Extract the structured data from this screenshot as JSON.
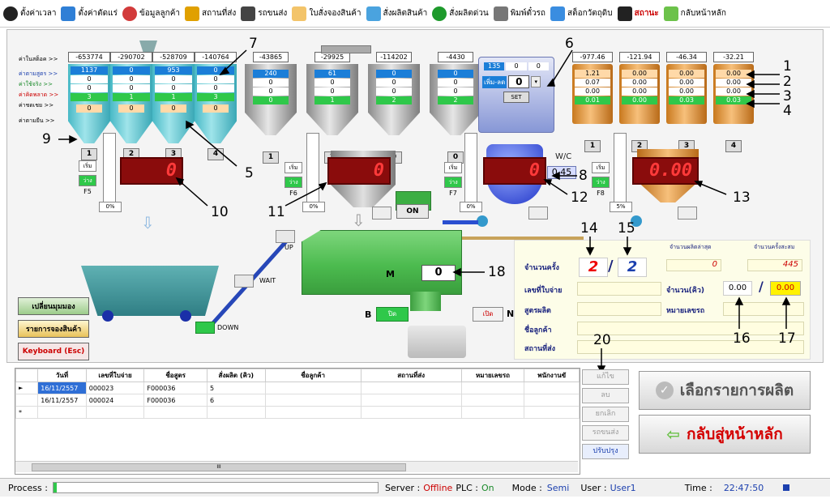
{
  "toolbar": {
    "items": [
      {
        "label": "ตั้งค่าเวลา",
        "icon": "clock-icon"
      },
      {
        "label": "ตั้งค่าตัดแร่",
        "icon": "checklist-icon"
      },
      {
        "label": "ข้อมูลลูกค้า",
        "icon": "users-icon"
      },
      {
        "label": "สถานที่ส่ง",
        "icon": "house-icon"
      },
      {
        "label": "รถขนส่ง",
        "icon": "truck-icon"
      },
      {
        "label": "ใบสั่งจองสินค้า",
        "icon": "document-icon"
      },
      {
        "label": "สั่งผลิตสินค้า",
        "icon": "key-icon"
      },
      {
        "label": "สั่งผลิตด่วน",
        "icon": "run-icon"
      },
      {
        "label": "พิมพ์ตั๋วรถ",
        "icon": "printer-icon"
      },
      {
        "label": "สต็อกวัตถุดิบ",
        "icon": "stock-icon"
      },
      {
        "label": "สถานะ",
        "icon": "monitor-icon"
      },
      {
        "label": "กลับหน้าหลัก",
        "icon": "back-arrow-icon"
      }
    ]
  },
  "left_labels": [
    "ค่าในสต็อค >>",
    "ค่าตามสูตร >>",
    "ค่าใช้จริง >>",
    "ค่าคิดพลาด >>",
    "ค่าชดเชย >>",
    "ค่าตามยืน >>"
  ],
  "aggregate_silos": [
    {
      "top": "-653774",
      "vals": [
        "1137",
        "0",
        "0",
        "3",
        "0"
      ],
      "num": "1"
    },
    {
      "top": "-290702",
      "vals": [
        "0",
        "0",
        "0",
        "1",
        "0"
      ],
      "num": "2"
    },
    {
      "top": "-528709",
      "vals": [
        "953",
        "0",
        "0",
        "1",
        "0"
      ],
      "num": "3"
    },
    {
      "top": "-140764",
      "vals": [
        "0",
        "0",
        "0",
        "3",
        "0"
      ],
      "num": "4"
    }
  ],
  "cement_silos": [
    {
      "top": "-43865",
      "vals": [
        "240",
        "0",
        "0",
        "0"
      ],
      "num": "1"
    },
    {
      "top": "-29925",
      "vals": [
        "61",
        "0",
        "0",
        "1"
      ],
      "num": "2"
    },
    {
      "top": "-114202",
      "vals": [
        "0",
        "0",
        "0",
        "2"
      ],
      "num": "0"
    },
    {
      "top": "-4430",
      "vals": [
        "0",
        "0",
        "0",
        "2"
      ],
      "num": "0"
    }
  ],
  "water_tank": {
    "vals": [
      "135",
      "0",
      "0"
    ],
    "add_label": "เพิ่ม-ลด",
    "adj_value": "0",
    "set_label": "SET"
  },
  "admix_silos": [
    {
      "top": "-977.46",
      "vals": [
        "1.21",
        "0.07",
        "0.00",
        "0.01"
      ],
      "num": "1"
    },
    {
      "top": "-121.94",
      "vals": [
        "0.00",
        "0.00",
        "0.00",
        "0.00"
      ],
      "num": "2"
    },
    {
      "top": "-46.34",
      "vals": [
        "0.00",
        "0.00",
        "0.00",
        "0.03"
      ],
      "num": "3"
    },
    {
      "top": "-32.21",
      "vals": [
        "0.00",
        "0.00",
        "0.00",
        "0.03"
      ],
      "num": "4"
    }
  ],
  "scales": [
    {
      "value": "0",
      "start": "เริ่ม",
      "stop": "ว่าง",
      "name": "F5",
      "pct": "0%"
    },
    {
      "value": "0",
      "start": "เริ่ม",
      "stop": "ว่าง",
      "name": "F6",
      "pct": "0%"
    },
    {
      "value": "0",
      "start": "เริ่ม",
      "stop": "ว่าง",
      "name": "F7",
      "pct": "0%"
    },
    {
      "value": "0.00",
      "start": "เริ่ม",
      "stop": "ว่าง",
      "name": "F8",
      "pct": "5%"
    }
  ],
  "wc": {
    "label": "W/C",
    "value": "0.45"
  },
  "mixer": {
    "on_label": "ON",
    "m_label": "M",
    "m_value": "0",
    "b_label": "B",
    "b_state": "ปิด",
    "n_label": "N",
    "n_state": "เปิด",
    "up": "UP",
    "wait": "WAIT",
    "down": "DOWN"
  },
  "side_buttons": {
    "view": "เปลี่ยนมุมมอง",
    "orders": "รายการจองสินค้า",
    "keyboard": "Keyboard (Esc)"
  },
  "batch": {
    "count_label": "จำนวนครั้ง",
    "count_current": "2",
    "count_total": "2",
    "produced_label": "จำนวนผลิตล่าสุด",
    "produced_value": "0",
    "cumulative_label": "จำนวนครั้งสะสม",
    "cumulative_value": "445",
    "bill_label": "เลขที่ใบจ่าย",
    "formula_label": "สูตรผลิต",
    "customer_label": "ชื่อลูกค้า",
    "site_label": "สถานที่ส่ง",
    "qty_label": "จำนวน(คิว)",
    "qty_current": "0.00",
    "qty_total": "0.00",
    "truck_label": "หมายเลขรถ"
  },
  "callouts": [
    "1",
    "2",
    "3",
    "4",
    "5",
    "6",
    "7",
    "8",
    "9",
    "10",
    "11",
    "12",
    "13",
    "14",
    "15",
    "16",
    "17",
    "18",
    "19",
    "20"
  ],
  "grid": {
    "columns": [
      "วันที่",
      "เลขที่ใบจ่าย",
      "ชื่อสูตร",
      "สั่งผลิต (คิว)",
      "ชื่อลูกค้า",
      "สถานที่ส่ง",
      "หมายเลขรถ",
      "พนักงานขั"
    ],
    "rows": [
      [
        "16/11/2557",
        "000023",
        "F000036",
        "5",
        "",
        "",
        "",
        ""
      ],
      [
        "16/11/2557",
        "000024",
        "F000036",
        "6",
        "",
        "",
        "",
        ""
      ]
    ],
    "new_row_marker": "*",
    "current_marker": "►",
    "hscroll_mark": "III"
  },
  "actions": [
    "แก้ไข",
    "ลบ",
    "ยกเลิก",
    "รถขนส่ง",
    "ปรับปรุง"
  ],
  "big_buttons": {
    "select": "เลือกรายการผลิต",
    "home": "กลับสู่หน้าหลัก"
  },
  "status": {
    "process_label": "Process :",
    "server_label": "Server :",
    "server_value": "Offline",
    "plc_label": "PLC :",
    "plc_value": "On",
    "mode_label": "Mode :",
    "mode_value": "Semi",
    "user_label": "User :",
    "user_value": "User1",
    "time_label": "Time :",
    "time_value": "22:47:50"
  },
  "colors": {
    "accent_blue": "#1b7ed8",
    "led_red": "#ff3a3a",
    "batch_red": "#e00000",
    "mixer_green": "#4cbb4f"
  }
}
